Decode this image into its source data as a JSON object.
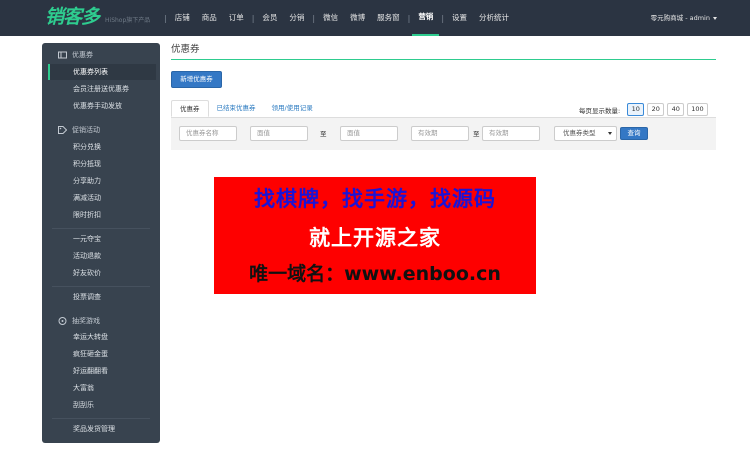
{
  "brand": {
    "logo_text": "销客多",
    "sub_text": "HiShop旗下产品"
  },
  "topnav": {
    "items": [
      "店铺",
      "商品",
      "订单",
      "会员",
      "分销",
      "微信",
      "微博",
      "服务窗",
      "营销",
      "设置",
      "分析统计"
    ],
    "active": "营销",
    "user": "零元购商城 - admin"
  },
  "sidebar": {
    "groups": [
      {
        "label": "优惠券",
        "icon": "ticket-icon",
        "items": [
          "优惠券列表",
          "会员注册送优惠券",
          "优惠券手动发放"
        ]
      },
      {
        "label": "促销活动",
        "icon": "tag-icon",
        "items": [
          "积分兑换",
          "积分抵现",
          "分享助力",
          "满减活动",
          "限时折扣"
        ]
      },
      {
        "label": "",
        "icon": "",
        "items": [
          "一元夺宝",
          "活动退款",
          "好友砍价"
        ]
      },
      {
        "label": "",
        "icon": "",
        "items": [
          "投票调查"
        ]
      },
      {
        "label": "抽奖游戏",
        "icon": "gamepad-icon",
        "items": [
          "幸运大转盘",
          "疯狂砸金蛋",
          "好运翻翻看",
          "大富翁",
          "刮刮乐"
        ]
      },
      {
        "label": "",
        "icon": "",
        "items": [
          "奖品发货管理"
        ]
      }
    ],
    "active_item": "优惠券列表"
  },
  "main": {
    "title": "优惠券",
    "add_button": "新增优惠券",
    "tabs": [
      "优惠券",
      "已结束优惠券",
      "领用/使用记录"
    ],
    "active_tab": "优惠券",
    "perpage": {
      "label": "每页显示数量:",
      "options": [
        "10",
        "20",
        "40",
        "100"
      ],
      "selected": "10"
    },
    "filters": {
      "name_placeholder": "优惠券名称",
      "min_value_placeholder": "面值",
      "to_label": "至",
      "max_value_placeholder": "面值",
      "start_date_placeholder": "有效期",
      "end_date_placeholder": "有效期",
      "type_select": "优惠券类型",
      "search_button": "查询"
    }
  },
  "banner": {
    "line1": "找棋牌，找手游，找源码",
    "line2": "就上开源之家",
    "line3": "唯一域名：www.enboo.cn"
  },
  "colors": {
    "topbar": "#2b3442",
    "sidebar": "#38434f",
    "accent": "#2ecc8f",
    "primary_button": "#3478c5",
    "banner_bg": "#fe0000",
    "banner_line1": "#1c13d6"
  }
}
